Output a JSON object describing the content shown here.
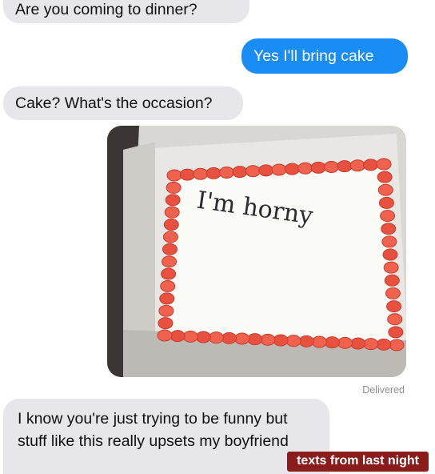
{
  "messages": [
    {
      "from": "them",
      "text": "Are you coming to dinner?"
    },
    {
      "from": "me",
      "text": "Yes I'll bring cake"
    },
    {
      "from": "them",
      "text": "Cake? What's the occasion?"
    },
    {
      "from": "me",
      "type": "image",
      "image_caption": "I'm horny"
    },
    {
      "from": "them",
      "text": "I know you're just trying to be funny but stuff like this really upsets my boyfriend"
    }
  ],
  "status": "Delivered",
  "watermark": "texts from last night",
  "colors": {
    "incoming": "#e6e6eb",
    "outgoing": "#1a8cf5",
    "watermark_bg": "#8b1c1c"
  }
}
